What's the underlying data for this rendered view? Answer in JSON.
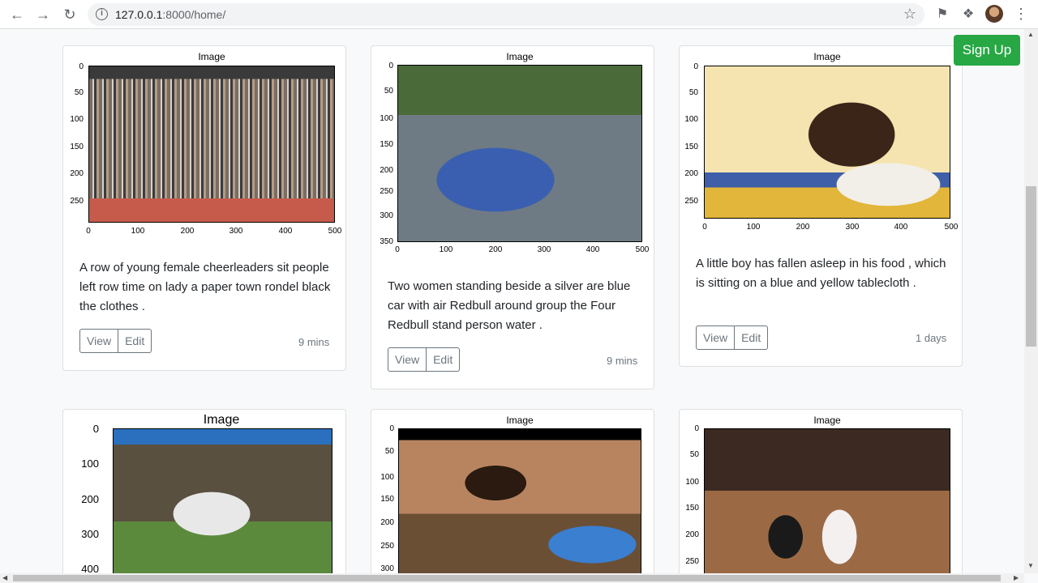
{
  "browser": {
    "url_host": "127.0.0.1",
    "url_rest": ":8000/home/"
  },
  "header": {
    "signup_label": "Sign Up"
  },
  "cards": [
    {
      "plot_title": "Image",
      "yticks": [
        "0",
        "50",
        "100",
        "150",
        "200",
        "250"
      ],
      "xticks": [
        "0",
        "100",
        "200",
        "300",
        "400",
        "500"
      ],
      "caption": "A row of young female cheerleaders sit people left row time on lady a paper town rondel black the clothes .",
      "view_label": "View",
      "edit_label": "Edit",
      "time": "9 mins"
    },
    {
      "plot_title": "Image",
      "yticks": [
        "0",
        "50",
        "100",
        "150",
        "200",
        "250",
        "300",
        "350"
      ],
      "xticks": [
        "0",
        "100",
        "200",
        "300",
        "400",
        "500"
      ],
      "caption": "Two women standing beside a silver are blue car with air Redbull around group the Four Redbull stand person water .",
      "view_label": "View",
      "edit_label": "Edit",
      "time": "9 mins"
    },
    {
      "plot_title": "Image",
      "yticks": [
        "0",
        "50",
        "100",
        "150",
        "200",
        "250"
      ],
      "xticks": [
        "0",
        "100",
        "200",
        "300",
        "400",
        "500"
      ],
      "caption": "A little boy has fallen asleep in his food , which is sitting on a blue and yellow tablecloth .",
      "view_label": "View",
      "edit_label": "Edit",
      "time": "1 days"
    },
    {
      "plot_title": "Image",
      "yticks": [
        "0",
        "100",
        "200",
        "300",
        "400"
      ],
      "xticks": []
    },
    {
      "plot_title": "Image",
      "yticks": [
        "0",
        "50",
        "100",
        "150",
        "200",
        "250",
        "300"
      ],
      "xticks": []
    },
    {
      "plot_title": "Image",
      "yticks": [
        "0",
        "50",
        "100",
        "150",
        "200",
        "250"
      ],
      "xticks": []
    }
  ]
}
